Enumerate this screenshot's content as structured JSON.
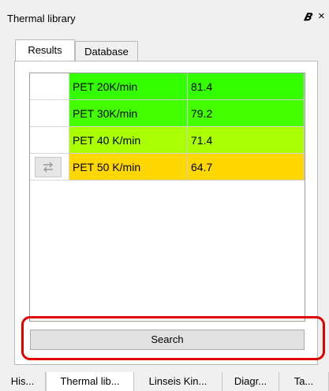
{
  "window": {
    "title": "Thermal library",
    "float_icon": "float-dock-icon",
    "close_icon": "close-icon"
  },
  "tabs": [
    {
      "label": "Results",
      "active": true
    },
    {
      "label": "Database",
      "active": false
    }
  ],
  "results": [
    {
      "name": "PET 20K/min",
      "value": "81.4",
      "color": "#33ff00",
      "has_icon": false
    },
    {
      "name": "PET 30K/min",
      "value": "79.2",
      "color": "#44ff00",
      "has_icon": false
    },
    {
      "name": "PET 40 K/min",
      "value": "71.4",
      "color": "#aaff00",
      "has_icon": false
    },
    {
      "name": "PET 50 K/min",
      "value": "64.7",
      "color": "#ffd700",
      "has_icon": true,
      "icon": "compare-arrows-icon"
    }
  ],
  "search_button": {
    "label": "Search"
  },
  "highlight_color": "#e00000",
  "bottom_tabs": [
    {
      "label": "His..."
    },
    {
      "label": "Thermal lib...",
      "active": true
    },
    {
      "label": "Linseis Kin..."
    },
    {
      "label": "Diagr..."
    },
    {
      "label": "Ta..."
    }
  ]
}
